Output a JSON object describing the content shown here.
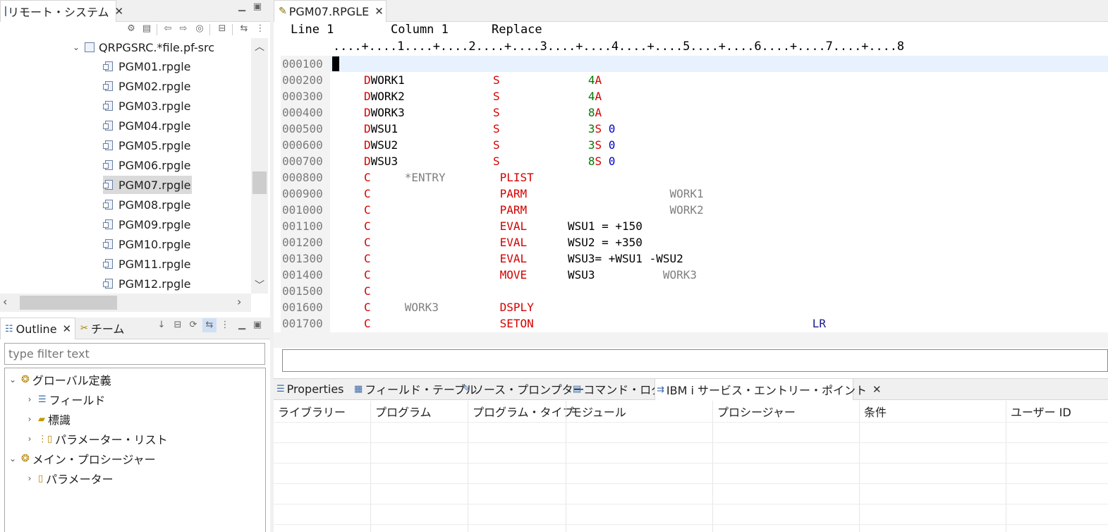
{
  "remote": {
    "tab_label": "リモート・システム",
    "folder": "QRPGSRC.*file.pf-src",
    "items": [
      "PGM01.rpgle",
      "PGM02.rpgle",
      "PGM03.rpgle",
      "PGM04.rpgle",
      "PGM05.rpgle",
      "PGM06.rpgle",
      "PGM07.rpgle",
      "PGM08.rpgle",
      "PGM09.rpgle",
      "PGM10.rpgle",
      "PGM11.rpgle",
      "PGM12.rpgle"
    ],
    "selected": "PGM07.rpgle"
  },
  "outline": {
    "tab_outline": "Outline",
    "tab_team": "チーム",
    "filter_placeholder": "type filter text",
    "tree": {
      "global": "グローバル定義",
      "fields": "フィールド",
      "indicators": "標識",
      "param_list": "パラメーター・リスト",
      "main_proc": "メイン・プロシージャー",
      "params": "パラメーター"
    }
  },
  "editor": {
    "tab_label": "PGM07.RPGLE",
    "status_line": "Line 1",
    "status_col": "Column 1",
    "status_mode": "Replace",
    "ruler": "....+....1....+....2....+....3....+....4....+....5....+....6....+....7....+....8",
    "lines": [
      {
        "seq": "000100",
        "parts": []
      },
      {
        "seq": "000200",
        "parts": [
          {
            "t": "     "
          },
          {
            "t": "D",
            "c": "red"
          },
          {
            "t": "WORK1",
            "c": "blk"
          },
          {
            "t": "             "
          },
          {
            "t": "S",
            "c": "red"
          },
          {
            "t": "             "
          },
          {
            "t": "4",
            "c": "grn"
          },
          {
            "t": "A",
            "c": "red"
          }
        ]
      },
      {
        "seq": "000300",
        "parts": [
          {
            "t": "     "
          },
          {
            "t": "D",
            "c": "red"
          },
          {
            "t": "WORK2",
            "c": "blk"
          },
          {
            "t": "             "
          },
          {
            "t": "S",
            "c": "red"
          },
          {
            "t": "             "
          },
          {
            "t": "4",
            "c": "grn"
          },
          {
            "t": "A",
            "c": "red"
          }
        ]
      },
      {
        "seq": "000400",
        "parts": [
          {
            "t": "     "
          },
          {
            "t": "D",
            "c": "red"
          },
          {
            "t": "WORK3",
            "c": "blk"
          },
          {
            "t": "             "
          },
          {
            "t": "S",
            "c": "red"
          },
          {
            "t": "             "
          },
          {
            "t": "8",
            "c": "grn"
          },
          {
            "t": "A",
            "c": "red"
          }
        ]
      },
      {
        "seq": "000500",
        "parts": [
          {
            "t": "     "
          },
          {
            "t": "D",
            "c": "red"
          },
          {
            "t": "WSU1",
            "c": "blk"
          },
          {
            "t": "              "
          },
          {
            "t": "S",
            "c": "red"
          },
          {
            "t": "             "
          },
          {
            "t": "3",
            "c": "grn"
          },
          {
            "t": "S",
            "c": "red"
          },
          {
            "t": " "
          },
          {
            "t": "0",
            "c": "blu"
          }
        ]
      },
      {
        "seq": "000600",
        "parts": [
          {
            "t": "     "
          },
          {
            "t": "D",
            "c": "red"
          },
          {
            "t": "WSU2",
            "c": "blk"
          },
          {
            "t": "              "
          },
          {
            "t": "S",
            "c": "red"
          },
          {
            "t": "             "
          },
          {
            "t": "3",
            "c": "grn"
          },
          {
            "t": "S",
            "c": "red"
          },
          {
            "t": " "
          },
          {
            "t": "0",
            "c": "blu"
          }
        ]
      },
      {
        "seq": "000700",
        "parts": [
          {
            "t": "     "
          },
          {
            "t": "D",
            "c": "red"
          },
          {
            "t": "WSU3",
            "c": "blk"
          },
          {
            "t": "              "
          },
          {
            "t": "S",
            "c": "red"
          },
          {
            "t": "             "
          },
          {
            "t": "8",
            "c": "grn"
          },
          {
            "t": "S",
            "c": "red"
          },
          {
            "t": " "
          },
          {
            "t": "0",
            "c": "blu"
          }
        ]
      },
      {
        "seq": "000800",
        "parts": [
          {
            "t": "     "
          },
          {
            "t": "C",
            "c": "red"
          },
          {
            "t": "     "
          },
          {
            "t": "*ENTRY",
            "c": "gry"
          },
          {
            "t": "        "
          },
          {
            "t": "PLIST",
            "c": "red"
          }
        ]
      },
      {
        "seq": "000900",
        "parts": [
          {
            "t": "     "
          },
          {
            "t": "C",
            "c": "red"
          },
          {
            "t": "                   "
          },
          {
            "t": "PARM",
            "c": "red"
          },
          {
            "t": "                     "
          },
          {
            "t": "WORK1",
            "c": "gry"
          }
        ]
      },
      {
        "seq": "001000",
        "parts": [
          {
            "t": "     "
          },
          {
            "t": "C",
            "c": "red"
          },
          {
            "t": "                   "
          },
          {
            "t": "PARM",
            "c": "red"
          },
          {
            "t": "                     "
          },
          {
            "t": "WORK2",
            "c": "gry"
          }
        ]
      },
      {
        "seq": "001100",
        "parts": [
          {
            "t": "     "
          },
          {
            "t": "C",
            "c": "red"
          },
          {
            "t": "                   "
          },
          {
            "t": "EVAL",
            "c": "red"
          },
          {
            "t": "      "
          },
          {
            "t": "WSU1 = +150",
            "c": "blk"
          }
        ]
      },
      {
        "seq": "001200",
        "parts": [
          {
            "t": "     "
          },
          {
            "t": "C",
            "c": "red"
          },
          {
            "t": "                   "
          },
          {
            "t": "EVAL",
            "c": "red"
          },
          {
            "t": "      "
          },
          {
            "t": "WSU2 = +350",
            "c": "blk"
          }
        ]
      },
      {
        "seq": "001300",
        "parts": [
          {
            "t": "     "
          },
          {
            "t": "C",
            "c": "red"
          },
          {
            "t": "                   "
          },
          {
            "t": "EVAL",
            "c": "red"
          },
          {
            "t": "      "
          },
          {
            "t": "WSU3= +WSU1 -WSU2",
            "c": "blk"
          }
        ]
      },
      {
        "seq": "001400",
        "parts": [
          {
            "t": "     "
          },
          {
            "t": "C",
            "c": "red"
          },
          {
            "t": "                   "
          },
          {
            "t": "MOVE",
            "c": "red"
          },
          {
            "t": "      "
          },
          {
            "t": "WSU3",
            "c": "blk"
          },
          {
            "t": "          "
          },
          {
            "t": "WORK3",
            "c": "gry"
          }
        ]
      },
      {
        "seq": "001500",
        "parts": [
          {
            "t": "     "
          },
          {
            "t": "C",
            "c": "red"
          }
        ]
      },
      {
        "seq": "001600",
        "parts": [
          {
            "t": "     "
          },
          {
            "t": "C",
            "c": "red"
          },
          {
            "t": "     "
          },
          {
            "t": "WORK3",
            "c": "gry"
          },
          {
            "t": "         "
          },
          {
            "t": "DSPLY",
            "c": "red"
          }
        ]
      },
      {
        "seq": "001700",
        "parts": [
          {
            "t": "     "
          },
          {
            "t": "C",
            "c": "red"
          },
          {
            "t": "                   "
          },
          {
            "t": "SETON",
            "c": "red"
          },
          {
            "t": "                                         "
          },
          {
            "t": "LR",
            "c": "nav"
          }
        ]
      }
    ]
  },
  "bottom": {
    "tabs": [
      "Properties",
      "フィールド・テーブル",
      "ソース・プロンプター",
      "コマンド・ログ",
      "IBM i サービス・エントリー・ポイント"
    ],
    "columns": [
      "ライブラリー",
      "プログラム",
      "プログラム・タイプ",
      "モジュール",
      "プロシージャー",
      "条件",
      "ユーザー ID"
    ]
  }
}
